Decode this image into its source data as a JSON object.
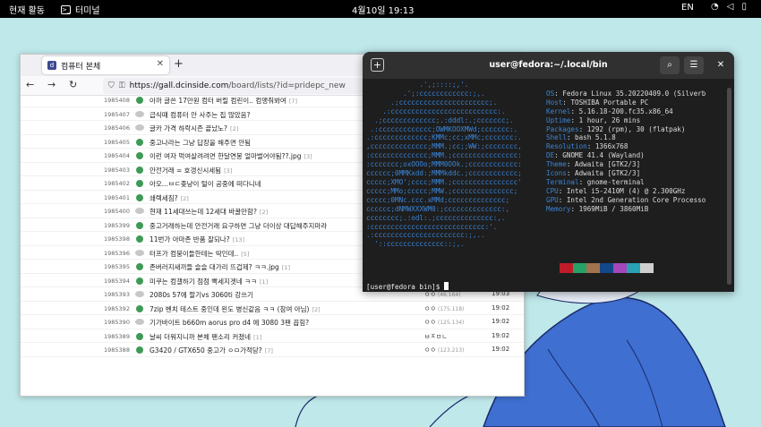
{
  "topbar": {
    "activities": "현재 활동",
    "app_name": "터미널",
    "clock": "4월10일  19:13",
    "lang": "EN",
    "icons": [
      "wifi-icon",
      "volume-icon",
      "battery-icon"
    ]
  },
  "browser": {
    "tab_title": "컴퓨터 본체",
    "url_host": "https://gall.dcinside.com",
    "url_path": "/board/lists/?id=pridepc_new",
    "rows": [
      {
        "num": "1985408",
        "icon": "pic",
        "title": "아까 글쓴 17만원 컴터 버릴 컴린이.. 컴맹줘봐여",
        "cmt": "[7]",
        "writer": "",
        "ip": "",
        "date": ""
      },
      {
        "num": "1985407",
        "icon": "speech",
        "title": "급식때 컴퓨터 안 사주는 집 많았음?",
        "cmt": "",
        "writer": "",
        "ip": "",
        "date": ""
      },
      {
        "num": "1985406",
        "icon": "speech",
        "title": "글카 가격 하락시즌 끝났노?",
        "cmt": "[2]",
        "writer": "",
        "ip": "",
        "date": ""
      },
      {
        "num": "1985405",
        "icon": "pic",
        "title": "중고나라는 그냥 답장을 해주면 안됨",
        "cmt": "",
        "writer": "",
        "ip": "",
        "date": ""
      },
      {
        "num": "1985404",
        "icon": "pic",
        "title": "이런 여자 먹여살려려면 한달연봉 얼마벌어야됨??.jpg",
        "cmt": "[3]",
        "writer": "",
        "ip": "",
        "date": ""
      },
      {
        "num": "1985403",
        "icon": "pic",
        "title": "안전거래 = 호갱신시세됨",
        "cmt": "[3]",
        "writer": "",
        "ip": "",
        "date": ""
      },
      {
        "num": "1985402",
        "icon": "pic",
        "title": "아오...ㅂㄷ좆냥이 털이 공중에 떠다니네",
        "cmt": "",
        "writer": "",
        "ip": "",
        "date": ""
      },
      {
        "num": "1985401",
        "icon": "pic",
        "title": "쇄렉세짐?",
        "cmt": "[2]",
        "writer": "",
        "ip": "",
        "date": ""
      },
      {
        "num": "1985400",
        "icon": "speech",
        "title": "현재 11세대쓰는데 12세대 바꿀만함?",
        "cmt": "[2]",
        "writer": "",
        "ip": "",
        "date": ""
      },
      {
        "num": "1985399",
        "icon": "pic",
        "title": "중고거래하는데 안전거래 요구하면 그냥 더이상 대답해주지마라",
        "cmt": "",
        "writer": "",
        "ip": "",
        "date": ""
      },
      {
        "num": "1985398",
        "icon": "pic",
        "title": "11번가 아마존 반품 잘되나?",
        "cmt": "[13]",
        "writer": "",
        "ip": "",
        "date": ""
      },
      {
        "num": "1985396",
        "icon": "speech",
        "title": "터프가 컴붕이들한테는 딱인데..",
        "cmt": "[5]",
        "writer": "",
        "ip": "",
        "date": ""
      },
      {
        "num": "1985395",
        "icon": "pic",
        "title": "존버러지새끼들 슬슬 대가리 뜨겁제? ㅋㅋ.jpg",
        "cmt": "[1]",
        "writer": "",
        "ip": "",
        "date": ""
      },
      {
        "num": "1985394",
        "icon": "pic",
        "title": "미쿠는 컴갤하기 점점 빡세지겟네 ㅋㅋ",
        "cmt": "[1]",
        "writer": "ㅇㅇ",
        "ip": "(122.34)",
        "date": "19:03"
      },
      {
        "num": "1985393",
        "icon": "speech",
        "title": "2080s 57에 팔기vs 3060ti 강쓰기",
        "cmt": "",
        "writer": "ㅇㅇ",
        "ip": "(46.164)",
        "date": "19:03"
      },
      {
        "num": "1985392",
        "icon": "pic",
        "title": "7zip 벤치 테스트 중인데 왼도 병신같음 ㅋㅋ (참여 아님)",
        "cmt": "[2]",
        "writer": "ㅇㅇ",
        "ip": "(175.118)",
        "date": "19:02"
      },
      {
        "num": "1985390",
        "icon": "speech",
        "title": "기가바이트 b660m aorus pro d4 에 3080 3팬 꼽힘?",
        "cmt": "",
        "writer": "ㅇㅇ",
        "ip": "(125.134)",
        "date": "19:02"
      },
      {
        "num": "1985389",
        "icon": "pic",
        "title": "날씨 더워지니까 본체 팬소리 커졌네",
        "cmt": "[1]",
        "writer": "ㅂㅈㅁㄴ",
        "ip": "",
        "date": "19:02"
      },
      {
        "num": "1985388",
        "icon": "pic",
        "title": "G3420 / GTX650 중고가 ㅇㅁ가적당?",
        "cmt": "[7]",
        "writer": "ㅇㅇ",
        "ip": "(123.213)",
        "date": "19:02"
      }
    ]
  },
  "terminal": {
    "title": "user@fedora:~/.local/bin",
    "logo_lines": [
      "             .',;::::;,'.",
      "         .';:cccccccccccc:;,.",
      "      .;cccccccccccccccccccccc;.",
      "    .:cccccccccccccccccccccccccc:.",
      "  .;ccccccccccccc;.:dddl:.;ccccccc;.",
      " .:ccccccccccccc;OWMKOOXMWd;ccccccc:.",
      ".:ccccccccccccc;KMMc;cc;xMMc;ccccccc:.",
      ",cccccccccccccc;MMM.;cc;;WW:;cccccccc,",
      ":cccccccccccccc;MMM.;cccccccccccccccc:",
      ":ccccccc;oxOOOo;MMM0OOk.;cccccccccccc:",
      "cccccc;0MMKxdd:;MMMkddc.;cccccccccccc;",
      "ccccc;XMO';cccc;MMM.;cccccccccccccccc'",
      "ccccc;MMo;ccccc;MMW.;ccccccccccccccc;",
      "ccccc;0MNc.ccc.xMMd;cccccccccccccc;",
      "cccccc;dNMWXXXWM0:;cccccccccccccc:,",
      "cccccccc;.:odl:.;cccccccccccccc:,.",
      ":cccccccccccccccccccccccccccc:'.",
      ".:cccccccccccccccccccccc:;,..",
      "  '::cccccccccccccc::;,."
    ],
    "info": [
      {
        "k": "",
        "v": ""
      },
      {
        "k": "OS",
        "v": "Fedora Linux 35.20220409.0 (Silverb"
      },
      {
        "k": "Host",
        "v": "TOSHIBA Portable PC"
      },
      {
        "k": "Kernel",
        "v": "5.16.18-200.fc35.x86_64"
      },
      {
        "k": "Uptime",
        "v": "1 hour, 26 mins"
      },
      {
        "k": "Packages",
        "v": "1292 (rpm), 30 (flatpak)"
      },
      {
        "k": "Shell",
        "v": "bash 5.1.8"
      },
      {
        "k": "Resolution",
        "v": "1366x768"
      },
      {
        "k": "DE",
        "v": "GNOME 41.4 (Wayland)"
      },
      {
        "k": "Theme",
        "v": "Adwaita [GTK2/3]"
      },
      {
        "k": "Icons",
        "v": "Adwaita [GTK2/3]"
      },
      {
        "k": "Terminal",
        "v": "gnome-terminal"
      },
      {
        "k": "CPU",
        "v": "Intel i5-2410M (4) @ 2.300GHz"
      },
      {
        "k": "GPU",
        "v": "Intel 2nd Generation Core Processo"
      },
      {
        "k": "Memory",
        "v": "1969MiB / 3860MiB"
      }
    ],
    "swatches_row1": [
      "#1e1e1e",
      "#c01c28",
      "#26a269",
      "#a2734c",
      "#12488b",
      "#a347ba",
      "#2aa1b3",
      "#cfcfcf"
    ],
    "swatches_row2": [
      "#5d5d5d",
      "#f66151",
      "#33d17a",
      "#e9ad0c",
      "#2a7bde",
      "#c061cb",
      "#33c7de",
      "#ffffff"
    ],
    "prompt": "[user@fedora bin]$ "
  }
}
